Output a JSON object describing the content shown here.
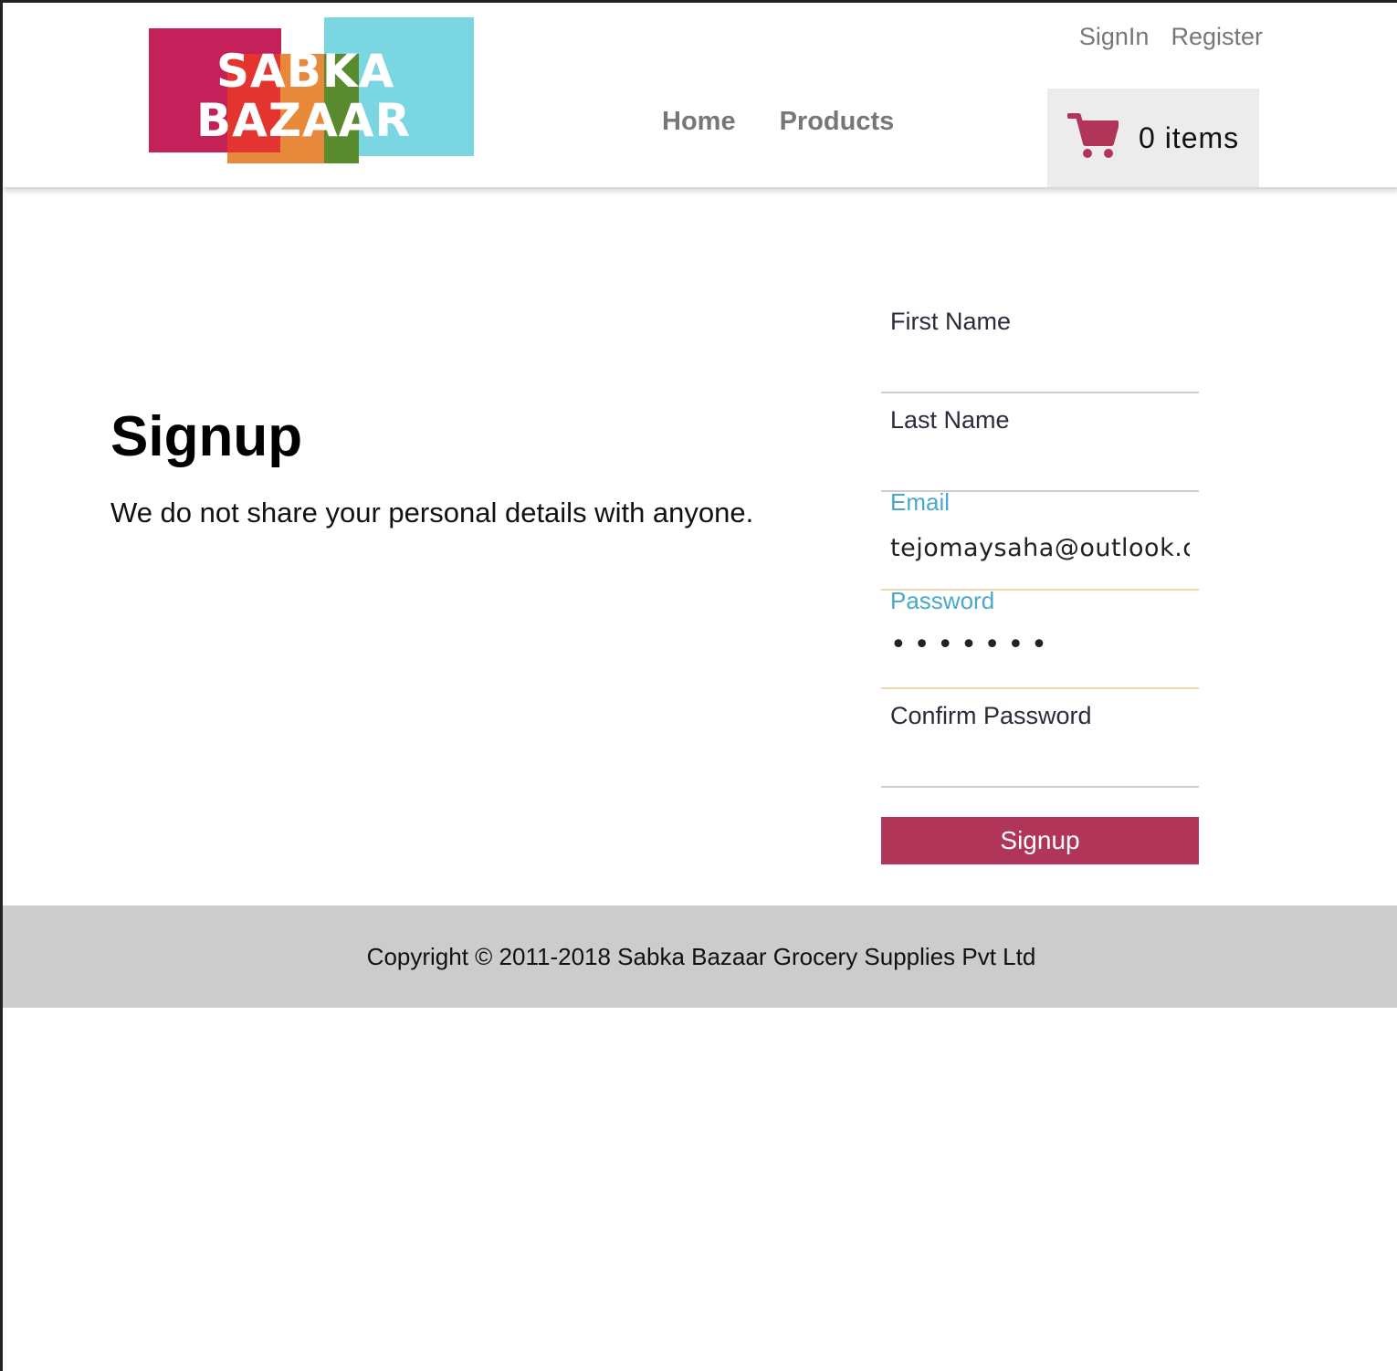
{
  "brand": {
    "logo_line1": "SABKA",
    "logo_line2": "BAZAAR",
    "colors": {
      "magenta": "#c4215a",
      "orange": "#e8883a",
      "red": "#e3342f",
      "cyan": "#7ad6e0",
      "green": "#5a8a2e"
    }
  },
  "header": {
    "top_links": {
      "signin": "SignIn",
      "register": "Register"
    },
    "nav": {
      "home": "Home",
      "products": "Products"
    },
    "cart": {
      "icon": "cart-icon",
      "count_label": "0 items",
      "icon_color": "#b03558"
    }
  },
  "intro": {
    "title": "Signup",
    "subtitle": "We do not share your personal details with anyone."
  },
  "form": {
    "first_name": {
      "label": "First Name",
      "value": ""
    },
    "last_name": {
      "label": "Last Name",
      "value": ""
    },
    "email": {
      "label": "Email",
      "value": "tejomaysaha@outlook.com"
    },
    "password": {
      "label": "Password",
      "value": "•••••••"
    },
    "confirm_password": {
      "label": "Confirm Password",
      "value": ""
    },
    "submit_label": "Signup",
    "accent_color": "#4aa9c9",
    "button_color": "#b03558"
  },
  "footer": {
    "copyright": "Copyright © 2011-2018 Sabka Bazaar Grocery Supplies Pvt Ltd"
  }
}
